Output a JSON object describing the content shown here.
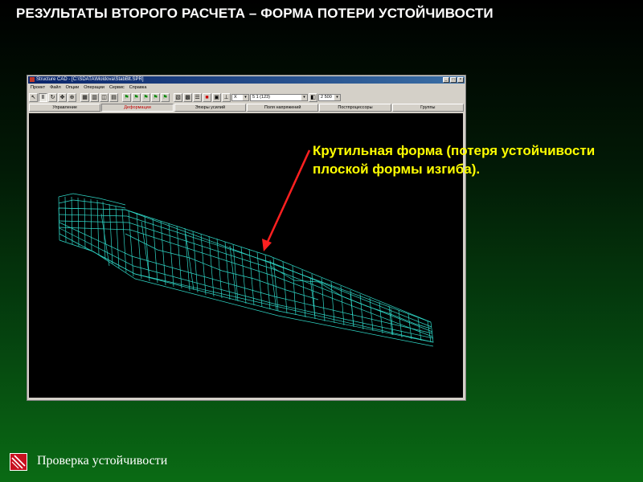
{
  "slide": {
    "title": "РЕЗУЛЬТАТЫ ВТОРОГО РАСЧЕТА – ФОРМА ПОТЕРИ УСТОЙЧИВОСТИ",
    "annotation": "Крутильная форма (потеря устойчивости плоской формы изгиба).",
    "footer": "Проверка устойчивости"
  },
  "app": {
    "window_title": "Structure CAD - [C:\\SDATA\\Moldova\\StabBlt.SPR]",
    "menu": [
      "Проект",
      "Файл",
      "Опции",
      "Операции",
      "Сервис",
      "Справка"
    ],
    "combo_axis": "X",
    "combo_load": "5 1 (123)",
    "combo_scale": "2 500",
    "mode_tabs": [
      "Управление",
      "Деформации",
      "Эпюры усилий",
      "Поля напряжений",
      "Постпроцессоры",
      "Группы"
    ]
  },
  "colors": {
    "mesh": "#2fd6c6",
    "arrow": "#ff2020",
    "annotation": "#ffff00",
    "title": "#ffffff"
  }
}
